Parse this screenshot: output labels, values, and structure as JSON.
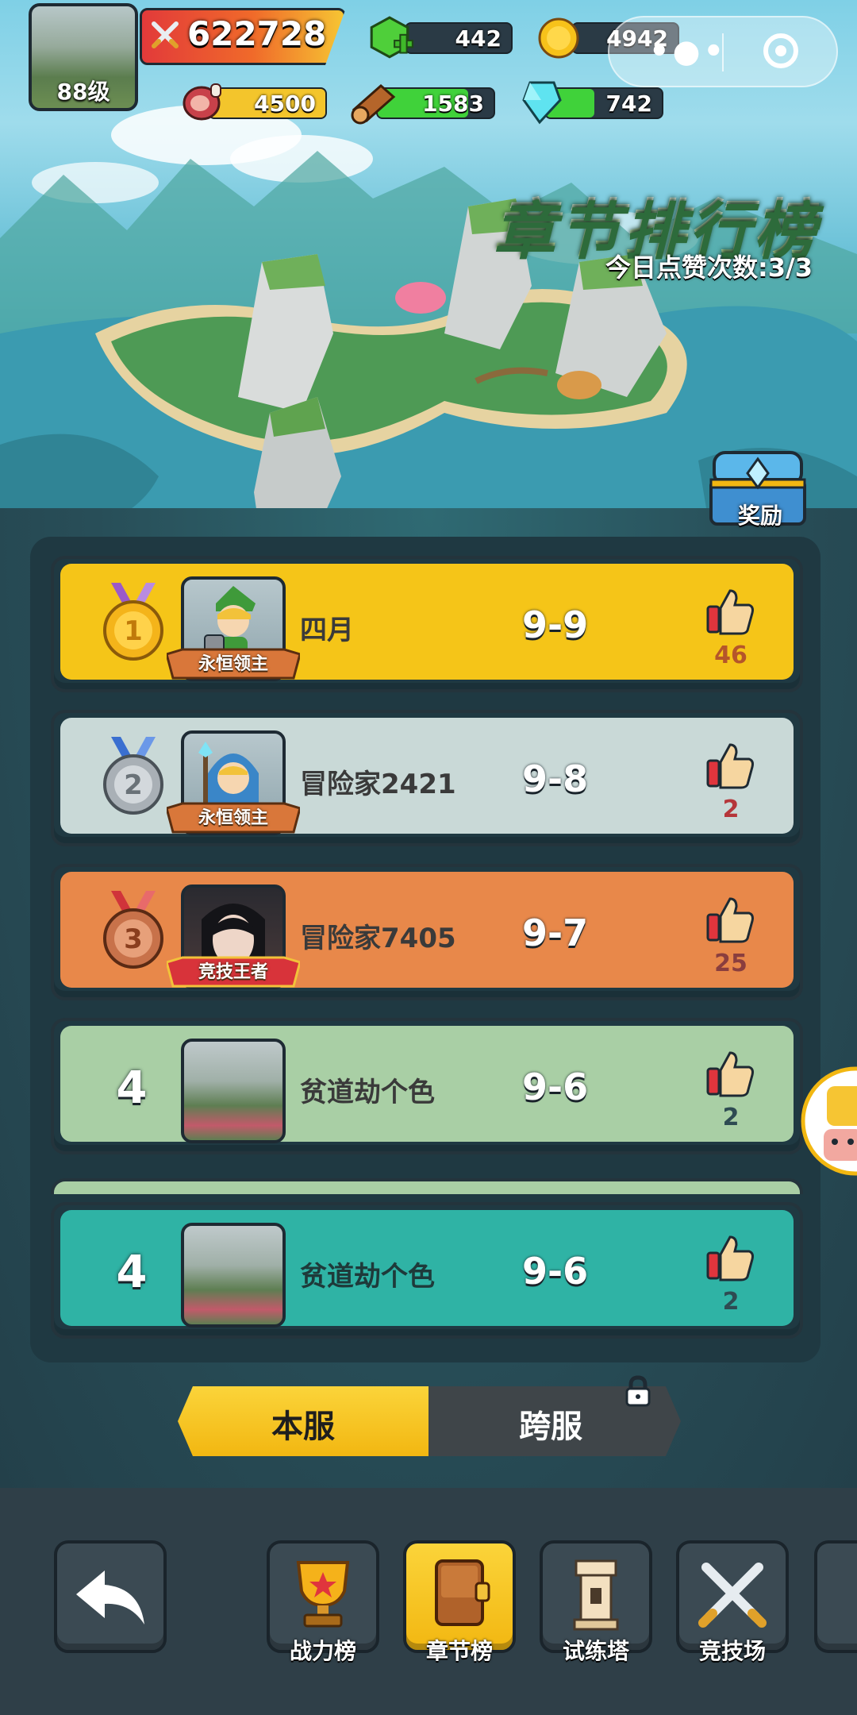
{
  "player": {
    "level_label": "88级",
    "power": "622728"
  },
  "resources": {
    "gems": "442",
    "gold": "4942",
    "meat": "4500",
    "wood": "1583",
    "crystal": "742"
  },
  "header": {
    "title": "章节排行榜",
    "likes_today": "今日点赞次数:3/3"
  },
  "reward": {
    "label": "奖励"
  },
  "leaderboard": {
    "rows": [
      {
        "rank": "1",
        "name": "四月",
        "stage": "9-9",
        "likes": "46",
        "title_tag": "永恒领主",
        "bg": "#f5c518",
        "like_color": "#b5562a"
      },
      {
        "rank": "2",
        "name": "冒险家2421",
        "stage": "9-8",
        "likes": "2",
        "title_tag": "永恒领主",
        "bg": "#c9d9d7",
        "like_color": "#b5363a"
      },
      {
        "rank": "3",
        "name": "冒险家7405",
        "stage": "9-7",
        "likes": "25",
        "title_tag": "竞技王者",
        "bg": "#e8884a",
        "like_color": "#8a3e3e"
      },
      {
        "rank": "4",
        "name": "贫道劫个色",
        "stage": "9-6",
        "likes": "2",
        "title_tag": "",
        "bg": "#a9cfa5",
        "like_color": "#2e4b52"
      }
    ],
    "self_row": {
      "rank": "4",
      "name": "贫道劫个色",
      "stage": "9-6",
      "likes": "2",
      "bg": "#2fb3a5",
      "like_color": "#2e4b52"
    }
  },
  "server_switch": {
    "local": "本服",
    "cross": "跨服"
  },
  "nav": {
    "back": "back",
    "items": [
      {
        "label": "战力榜",
        "icon": "trophy-icon",
        "active": false
      },
      {
        "label": "章节榜",
        "icon": "book-icon",
        "active": true
      },
      {
        "label": "试练塔",
        "icon": "tower-icon",
        "active": false
      },
      {
        "label": "竞技场",
        "icon": "crossed-swords-icon",
        "active": false
      }
    ]
  },
  "colors": {
    "gold": "#f5c518",
    "silver": "#c9d9d7",
    "bronze": "#e8884a",
    "green": "#a9cfa5",
    "teal": "#2fb3a5"
  }
}
